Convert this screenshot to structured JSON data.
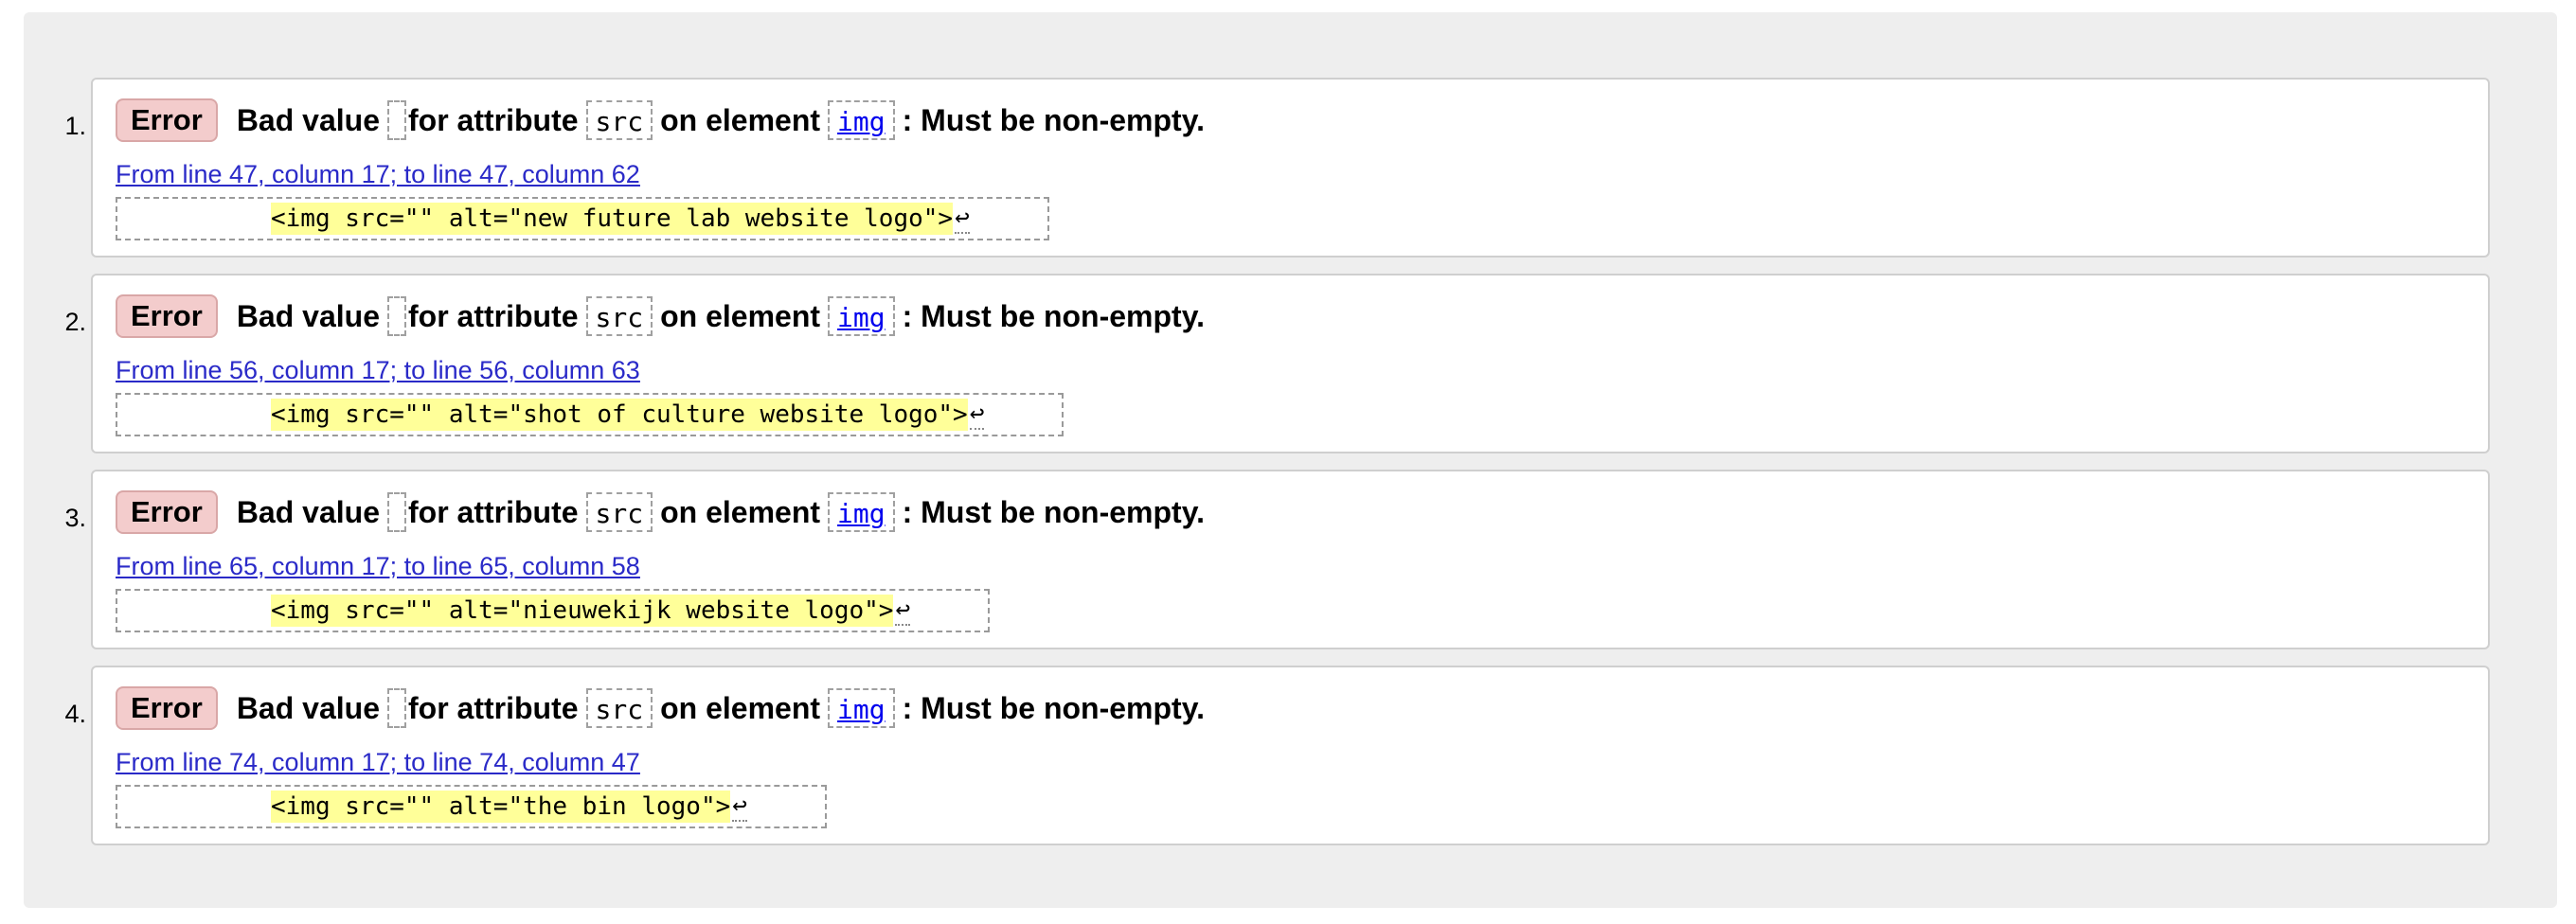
{
  "colors": {
    "panel_bg": "#eeeeee",
    "error_badge_bg": "#f3cccc",
    "highlight": "#ffff99",
    "link": "#2a2ac8"
  },
  "messages": [
    {
      "number": "1.",
      "badge": "Error",
      "t1": "Bad value",
      "t2": "for attribute",
      "attr": "src",
      "t3": "on element",
      "element": "img",
      "t4": ": Must be non-empty.",
      "location": "From line 47, column 17; to line 47, column 62",
      "extract": "<img src=\"\" alt=\"new future lab website logo\">",
      "linefeed": "↩"
    },
    {
      "number": "2.",
      "badge": "Error",
      "t1": "Bad value",
      "t2": "for attribute",
      "attr": "src",
      "t3": "on element",
      "element": "img",
      "t4": ": Must be non-empty.",
      "location": "From line 56, column 17; to line 56, column 63",
      "extract": "<img src=\"\" alt=\"shot of culture website logo\">",
      "linefeed": "↩"
    },
    {
      "number": "3.",
      "badge": "Error",
      "t1": "Bad value",
      "t2": "for attribute",
      "attr": "src",
      "t3": "on element",
      "element": "img",
      "t4": ": Must be non-empty.",
      "location": "From line 65, column 17; to line 65, column 58",
      "extract": "<img src=\"\" alt=\"nieuwekijk website logo\">",
      "linefeed": "↩"
    },
    {
      "number": "4.",
      "badge": "Error",
      "t1": "Bad value",
      "t2": "for attribute",
      "attr": "src",
      "t3": "on element",
      "element": "img",
      "t4": ": Must be non-empty.",
      "location": "From line 74, column 17; to line 74, column 47",
      "extract": "<img src=\"\" alt=\"the bin logo\">",
      "linefeed": "↩"
    }
  ]
}
